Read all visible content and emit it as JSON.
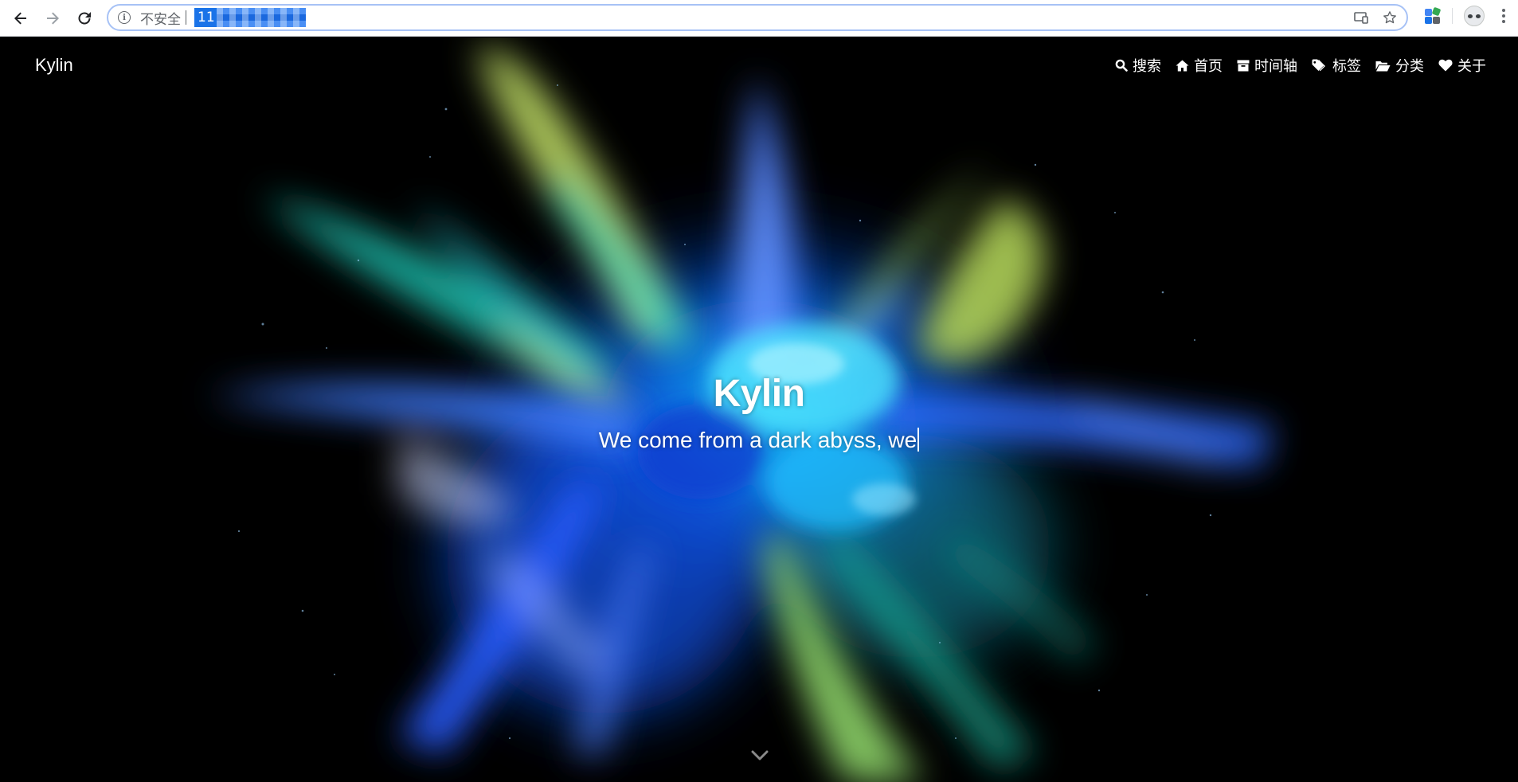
{
  "browser": {
    "security_label": "不安全",
    "url_visible_prefix": "11",
    "colors": {
      "omnibox_border": "#a7c2f6",
      "url_highlight": "#1a73e8"
    },
    "icons": {
      "back": "arrow-left-icon",
      "forward": "arrow-right-icon",
      "reload": "reload-icon",
      "info": "info-icon",
      "cast": "cast-icon",
      "star": "star-icon",
      "extension": "extension-icon",
      "profile": "profile-avatar-icon",
      "menu": "kebab-menu-icon"
    }
  },
  "site": {
    "brand": "Kylin",
    "nav": [
      {
        "label": "搜索",
        "icon": "search-icon"
      },
      {
        "label": "首页",
        "icon": "home-icon"
      },
      {
        "label": "时间轴",
        "icon": "archive-icon"
      },
      {
        "label": "标签",
        "icon": "tags-icon"
      },
      {
        "label": "分类",
        "icon": "folder-open-icon"
      },
      {
        "label": "关于",
        "icon": "heart-icon"
      }
    ],
    "hero": {
      "title": "Kylin",
      "subtitle": "We come from a dark abyss, we"
    },
    "scroll_icon": "chevron-down-icon"
  }
}
